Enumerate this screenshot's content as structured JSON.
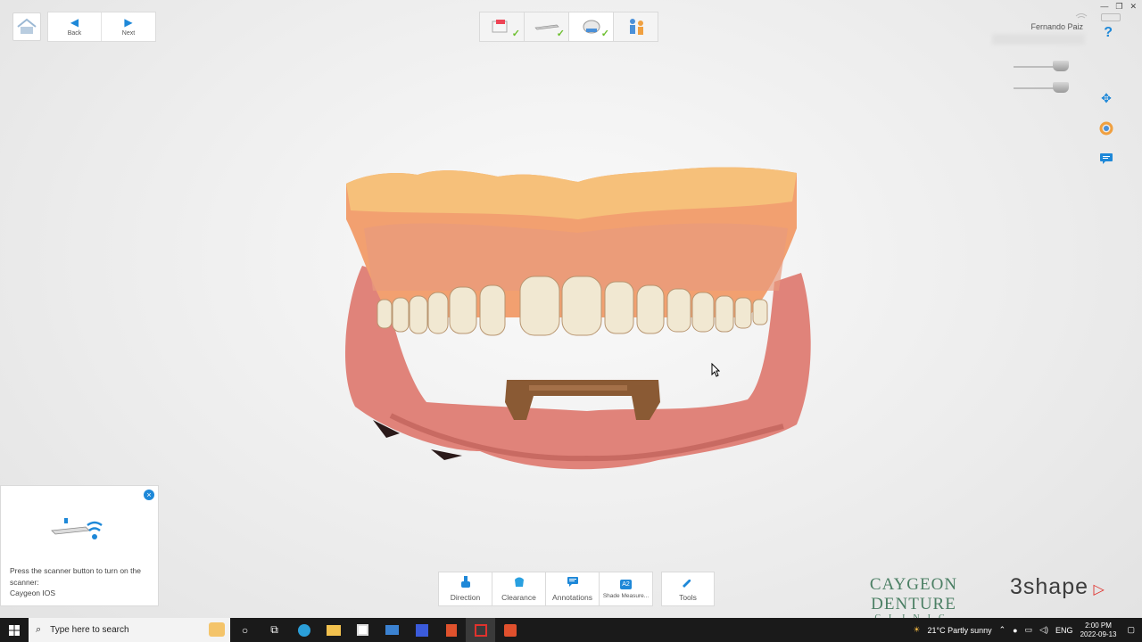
{
  "nav": {
    "back_label": "Back",
    "next_label": "Next"
  },
  "header": {
    "username": "Fernando Paiz",
    "help_label": "?"
  },
  "steps": [
    {
      "name": "order-step",
      "completed": true
    },
    {
      "name": "scanner-step",
      "completed": true
    },
    {
      "name": "scan-step",
      "completed": true
    },
    {
      "name": "send-step",
      "completed": false
    }
  ],
  "notification": {
    "close_label": "×",
    "message_line1": "Press the scanner button to turn on the scanner:",
    "message_line2": "Caygeon IOS"
  },
  "toolbar": {
    "direction_label": "Direction",
    "clearance_label": "Clearance",
    "annotations_label": "Annotations",
    "shade_label": "Shade Measure...",
    "shade_badge": "A2",
    "tools_label": "Tools"
  },
  "logos": {
    "clinic_name": "CAYGEON DENTURE",
    "clinic_sub": "CLINIC",
    "brand": "3shape"
  },
  "taskbar": {
    "search_placeholder": "Type here to search",
    "weather": "21°C  Partly sunny",
    "language": "ENG",
    "time": "2:00 PM",
    "date": "2022-09-13"
  },
  "colors": {
    "accent": "#1e88d8",
    "check": "#6cbf2e",
    "brand_green": "#4b7f64",
    "brand_red": "#e0322d"
  }
}
